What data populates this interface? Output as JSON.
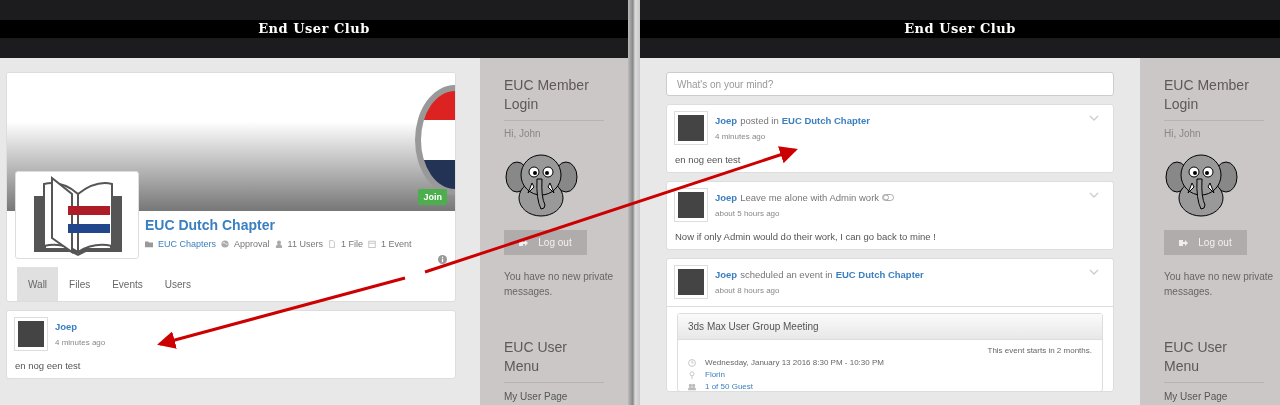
{
  "screens": [
    {
      "header": {
        "title": "End User Club"
      },
      "group": {
        "name": "EUC Dutch Chapter",
        "join": "Join",
        "meta": [
          {
            "kind": "category",
            "text": "EUC Chapters",
            "link": true
          },
          {
            "kind": "privacy",
            "text": "Approval",
            "link": false
          },
          {
            "kind": "members",
            "text": "11 Users",
            "link": false
          },
          {
            "kind": "files",
            "text": "1 File",
            "link": false
          },
          {
            "kind": "events",
            "text": "1 Event",
            "link": false
          }
        ],
        "tabs": [
          {
            "label": "Wall",
            "selected": true
          },
          {
            "label": "Files",
            "selected": false
          },
          {
            "label": "Events",
            "selected": false
          },
          {
            "label": "Users",
            "selected": false
          }
        ]
      },
      "posts": [
        {
          "author": "Joep",
          "time": "4 minutes ago",
          "body": "en nog een test"
        }
      ],
      "sidebar": {
        "login_title": "EUC Member Login",
        "greeting": "Hi, John",
        "logout": "Log out",
        "messages": "You have no new private messages.",
        "menu_title": "EUC User Menu",
        "menu_items": [
          "My User Page"
        ]
      }
    },
    {
      "header": {
        "title": "End User Club"
      },
      "composer": {
        "placeholder": "What's on your mind?"
      },
      "posts": [
        {
          "author": "Joep",
          "action": "posted in",
          "target": "EUC Dutch Chapter",
          "time": "4 minutes ago",
          "body": "en nog een test",
          "menu": true
        },
        {
          "author": "Joep",
          "action": "Leave me alone with Admin work",
          "shared_icon": true,
          "time": "about 5 hours ago",
          "body": "Now if only Admin would do their work, I can go back to mine !",
          "menu": true
        },
        {
          "author": "Joep",
          "action": "scheduled an event in",
          "target": "EUC Dutch Chapter",
          "time": "about 8 hours ago",
          "menu": true,
          "event": {
            "title": "3ds Max User Group Meeting",
            "starts": "This event starts in 2 months.",
            "date": "Wednesday, January 13 2016 8:30 PM - 10:30 PM",
            "location": "Florin",
            "guests": "1 of 50 Guest"
          }
        }
      ],
      "sidebar": {
        "login_title": "EUC Member Login",
        "greeting": "Hi, John",
        "logout": "Log out",
        "messages": "You have no new private messages.",
        "menu_title": "EUC User Menu",
        "menu_items": [
          "My User Page"
        ]
      }
    }
  ]
}
